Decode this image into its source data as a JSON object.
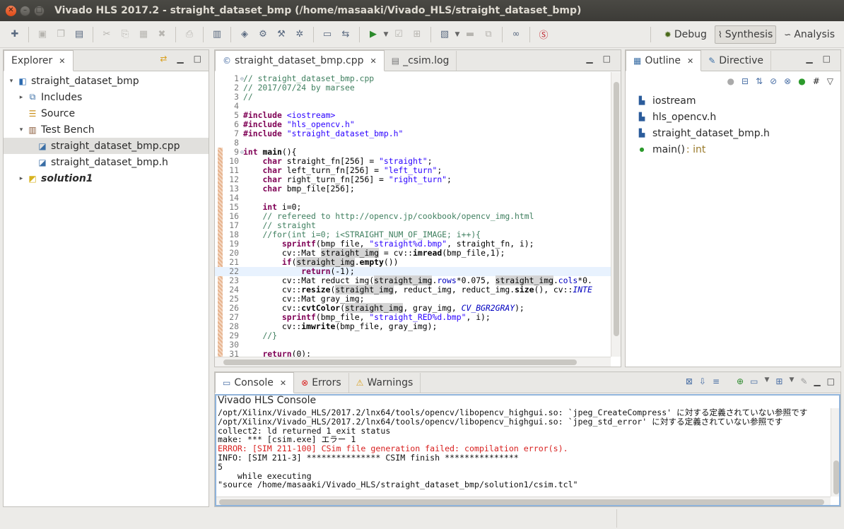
{
  "window": {
    "title": "Vivado HLS 2017.2 - straight_dataset_bmp (/home/masaaki/Vivado_HLS/straight_dataset_bmp)"
  },
  "perspectives": {
    "debug": "Debug",
    "synthesis": "Synthesis",
    "analysis": "Analysis",
    "active": "Synthesis"
  },
  "explorer": {
    "tab_label": "Explorer",
    "items": [
      {
        "label": "straight_dataset_bmp",
        "level": 0,
        "twisty": "▾",
        "icon": "project-icon"
      },
      {
        "label": "Includes",
        "level": 1,
        "twisty": "▸",
        "icon": "includes-icon"
      },
      {
        "label": "Source",
        "level": 1,
        "twisty": "",
        "icon": "source-folder-icon"
      },
      {
        "label": "Test Bench",
        "level": 1,
        "twisty": "▾",
        "icon": "testbench-icon"
      },
      {
        "label": "straight_dataset_bmp.cpp",
        "level": 2,
        "twisty": "",
        "icon": "cpp-file-icon",
        "selected": true
      },
      {
        "label": "straight_dataset_bmp.h",
        "level": 2,
        "twisty": "",
        "icon": "h-file-icon"
      },
      {
        "label": "solution1",
        "level": 1,
        "twisty": "▸",
        "icon": "solution-folder-icon",
        "bold_italic": true
      }
    ]
  },
  "editor": {
    "tabs": [
      {
        "label": "straight_dataset_bmp.cpp",
        "active": true,
        "closable": true
      },
      {
        "label": "_csim.log",
        "active": false,
        "closable": false
      }
    ],
    "current_line": 22,
    "lines": [
      {
        "n": "1",
        "fold": "⊖",
        "html": "<span class='cm'>// straight_dataset_bmp.cpp</span>"
      },
      {
        "n": "2",
        "fold": "",
        "html": "<span class='cm'>// 2017/07/24 by marsee</span>"
      },
      {
        "n": "3",
        "fold": "",
        "html": "<span class='cm'>//</span>"
      },
      {
        "n": "4",
        "fold": "",
        "html": ""
      },
      {
        "n": "5",
        "fold": "",
        "html": "<span class='pp'>#include</span> <span class='st'>&lt;iostream&gt;</span>"
      },
      {
        "n": "6",
        "fold": "",
        "html": "<span class='pp'>#include</span> <span class='st'>\"hls_opencv.h\"</span>"
      },
      {
        "n": "7",
        "fold": "",
        "html": "<span class='pp'>#include</span> <span class='st'>\"straight_dataset_bmp.h\"</span>"
      },
      {
        "n": "8",
        "fold": "",
        "html": ""
      },
      {
        "n": "9",
        "fold": "⊖",
        "html": "<span class='kw'>int</span> <b>main</b>(){"
      },
      {
        "n": "10",
        "fold": "",
        "html": "    <span class='kw'>char</span> straight_fn[256] = <span class='st'>\"straight\"</span>;"
      },
      {
        "n": "11",
        "fold": "",
        "html": "    <span class='kw'>char</span> left_turn_fn[256] = <span class='st'>\"left_turn\"</span>;"
      },
      {
        "n": "12",
        "fold": "",
        "html": "    <span class='kw'>char</span> right_turn_fn[256] = <span class='st'>\"right_turn\"</span>;"
      },
      {
        "n": "13",
        "fold": "",
        "html": "    <span class='kw'>char</span> bmp_file[256];"
      },
      {
        "n": "14",
        "fold": "",
        "html": ""
      },
      {
        "n": "15",
        "fold": "",
        "html": "    <span class='kw'>int</span> i=0;"
      },
      {
        "n": "16",
        "fold": "",
        "html": "    <span class='cm'>// refereed to http://opencv.jp/cookbook/opencv_img.html</span>"
      },
      {
        "n": "17",
        "fold": "",
        "html": "    <span class='cm'>// straight</span>"
      },
      {
        "n": "18",
        "fold": "",
        "html": "    <span class='cm'>//for(int i=0; i&lt;STRAIGHT_NUM_OF_IMAGE; i++){</span>"
      },
      {
        "n": "19",
        "fold": "",
        "html": "        <span class='fn'>sprintf</span>(bmp_file, <span class='st'>\"straight%d.bmp\"</span>, straight_fn, i);"
      },
      {
        "n": "20",
        "fold": "",
        "html": "        cv::Mat <span class='hl'>straight_img</span> = cv::<b>imread</b>(bmp_file,1);"
      },
      {
        "n": "21",
        "fold": "",
        "html": "        <span class='kw'>if</span>(<span class='hl'>straight_img</span>.<b>empty</b>())"
      },
      {
        "n": "22",
        "fold": "",
        "html": "            <span class='kw'>return</span>(-1);"
      },
      {
        "n": "23",
        "fold": "",
        "html": "        cv::Mat reduct_img(<span class='hl'>straight_img</span>.<span class='fd'>rows</span>*0.075, <span class='hl'>straight_img</span>.<span class='fd'>cols</span>*0."
      },
      {
        "n": "24",
        "fold": "",
        "html": "        cv::<b>resize</b>(<span class='hl'>straight_img</span>, reduct_img, reduct_img.<b>size</b>(), cv::<span class='it'>INTE</span>"
      },
      {
        "n": "25",
        "fold": "",
        "html": "        cv::Mat gray_img;"
      },
      {
        "n": "26",
        "fold": "",
        "html": "        cv::<b>cvtColor</b>(<span class='hl'>straight_img</span>, gray_img, <span class='it'>CV_BGR2GRAY</span>);"
      },
      {
        "n": "27",
        "fold": "",
        "html": "        <span class='fn'>sprintf</span>(bmp_file, <span class='st'>\"straight_RED%d.bmp\"</span>, i);"
      },
      {
        "n": "28",
        "fold": "",
        "html": "        cv::<b>imwrite</b>(bmp_file, gray_img);"
      },
      {
        "n": "29",
        "fold": "",
        "html": "    <span class='cm'>//}</span>"
      },
      {
        "n": "30",
        "fold": "",
        "html": ""
      },
      {
        "n": "31",
        "fold": "",
        "html": "    <span class='kw'>return</span>(0);"
      }
    ]
  },
  "outline": {
    "tabs": [
      {
        "label": "Outline",
        "active": true
      },
      {
        "label": "Directive",
        "active": false
      }
    ],
    "items": [
      {
        "label": "iostream",
        "type": "",
        "icon": "include-icon"
      },
      {
        "label": "hls_opencv.h",
        "type": "",
        "icon": "include-icon"
      },
      {
        "label": "straight_dataset_bmp.h",
        "type": "",
        "icon": "include-icon"
      },
      {
        "label": "main()",
        "type": ": int",
        "icon": "function-icon"
      }
    ]
  },
  "console": {
    "tabs": [
      {
        "label": "Console",
        "active": true
      },
      {
        "label": "Errors",
        "active": false
      },
      {
        "label": "Warnings",
        "active": false
      }
    ],
    "title": "Vivado HLS Console",
    "lines": [
      {
        "text": "/opt/Xilinx/Vivado_HLS/2017.2/lnx64/tools/opencv/libopencv_highgui.so: `jpeg_CreateCompress' に対する定義されていない参照です",
        "err": false
      },
      {
        "text": "/opt/Xilinx/Vivado_HLS/2017.2/lnx64/tools/opencv/libopencv_highgui.so: `jpeg_std_error' に対する定義されていない参照です",
        "err": false
      },
      {
        "text": "collect2: ld returned 1 exit status",
        "err": false
      },
      {
        "text": "make: *** [csim.exe] エラー 1",
        "err": false
      },
      {
        "text": "ERROR: [SIM 211-100] CSim file generation failed: compilation error(s).",
        "err": true
      },
      {
        "text": "INFO: [SIM 211-3] *************** CSIM finish ***************",
        "err": false
      },
      {
        "text": "5",
        "err": false
      },
      {
        "text": "    while executing",
        "err": false
      },
      {
        "text": "\"source /home/masaaki/Vivado_HLS/straight_dataset_bmp/solution1/csim.tcl\"",
        "err": false
      }
    ]
  }
}
